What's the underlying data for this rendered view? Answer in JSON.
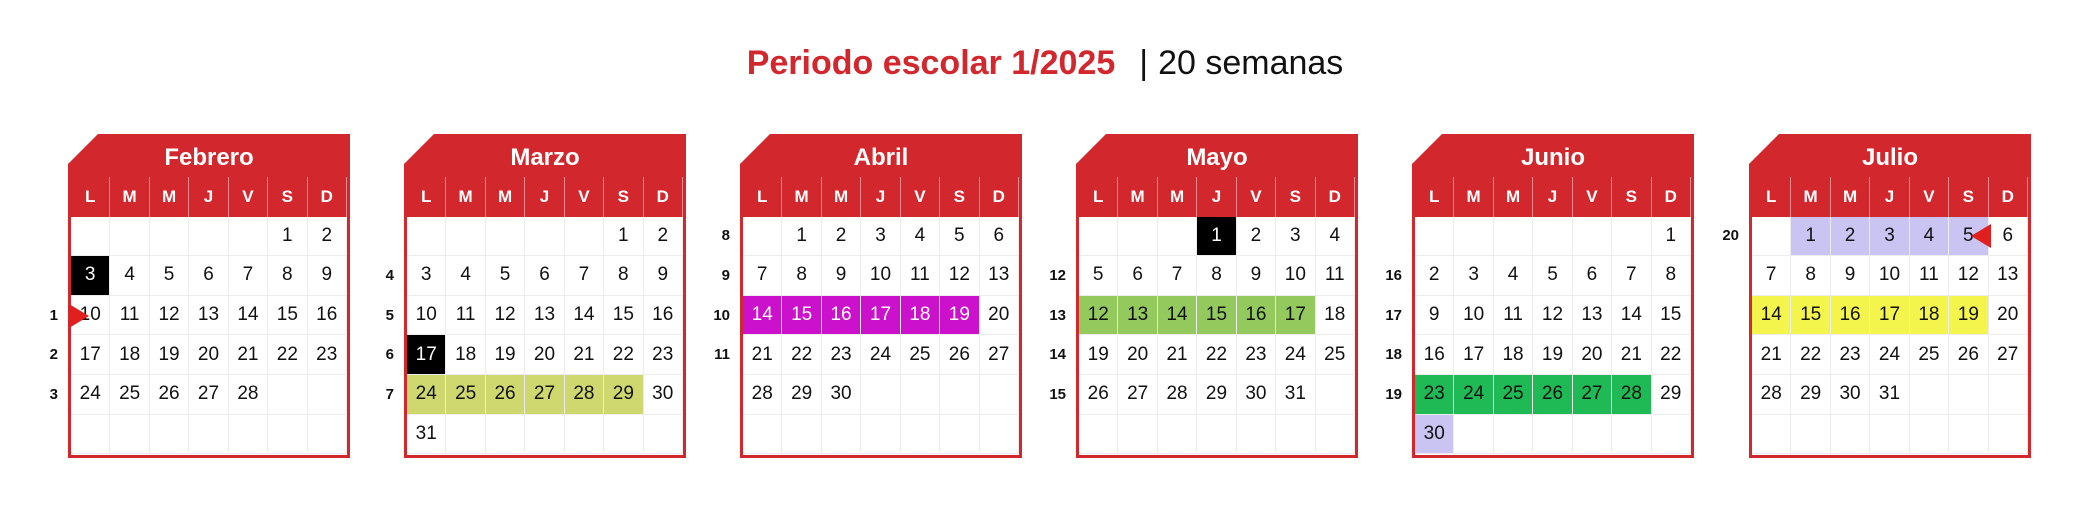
{
  "title": {
    "main": "Periodo escolar 1/2025",
    "separator": "|",
    "weeks": "20 semanas"
  },
  "weekday_labels": [
    "L",
    "M",
    "M",
    "J",
    "V",
    "S",
    "D"
  ],
  "colors": {
    "brand_red": "#d3272e",
    "marker_black": "#000000",
    "magenta": "#cc11cc",
    "olive": "#cfd86f",
    "light_green": "#93c95d",
    "green": "#1fba55",
    "lavender": "#c9c4f2",
    "yellow": "#f4f54c"
  },
  "months": [
    {
      "name": "Febrero",
      "first_weekday": 5,
      "days": 28,
      "week_numbers": [
        "",
        "",
        "1",
        "2",
        "3",
        ""
      ],
      "highlights": {
        "3": "black"
      },
      "markers": [
        {
          "type": "arrow-right",
          "day": 10
        }
      ]
    },
    {
      "name": "Marzo",
      "first_weekday": 5,
      "days": 31,
      "week_numbers": [
        "",
        "4",
        "5",
        "6",
        "7",
        ""
      ],
      "highlights": {
        "17": "black",
        "24": "olive",
        "25": "olive",
        "26": "olive",
        "27": "olive",
        "28": "olive",
        "29": "olive"
      },
      "markers": []
    },
    {
      "name": "Abril",
      "first_weekday": 1,
      "days": 30,
      "week_numbers": [
        "8",
        "9",
        "10",
        "11",
        "",
        ""
      ],
      "highlights": {
        "14": "magenta",
        "15": "magenta",
        "16": "magenta",
        "17": "magenta",
        "18": "magenta",
        "19": "magenta"
      },
      "markers": []
    },
    {
      "name": "Mayo",
      "first_weekday": 3,
      "days": 31,
      "week_numbers": [
        "",
        "12",
        "13",
        "14",
        "15",
        ""
      ],
      "highlights": {
        "1": "black",
        "12": "green1",
        "13": "green1",
        "14": "green1",
        "15": "green1",
        "16": "green1",
        "17": "green1"
      },
      "markers": []
    },
    {
      "name": "Junio",
      "first_weekday": 6,
      "days": 30,
      "week_numbers": [
        "",
        "16",
        "17",
        "18",
        "19",
        ""
      ],
      "highlights": {
        "23": "green2",
        "24": "green2",
        "25": "green2",
        "26": "green2",
        "27": "green2",
        "28": "green2",
        "30": "lav"
      },
      "markers": []
    },
    {
      "name": "Julio",
      "first_weekday": 1,
      "days": 31,
      "week_numbers": [
        "20",
        "",
        "",
        "",
        "",
        ""
      ],
      "highlights": {
        "1": "lav",
        "2": "lav",
        "3": "lav",
        "4": "lav",
        "5": "lav",
        "14": "yellow",
        "15": "yellow",
        "16": "yellow",
        "17": "yellow",
        "18": "yellow",
        "19": "yellow"
      },
      "markers": [
        {
          "type": "arrow-left",
          "day": 5
        }
      ]
    }
  ]
}
